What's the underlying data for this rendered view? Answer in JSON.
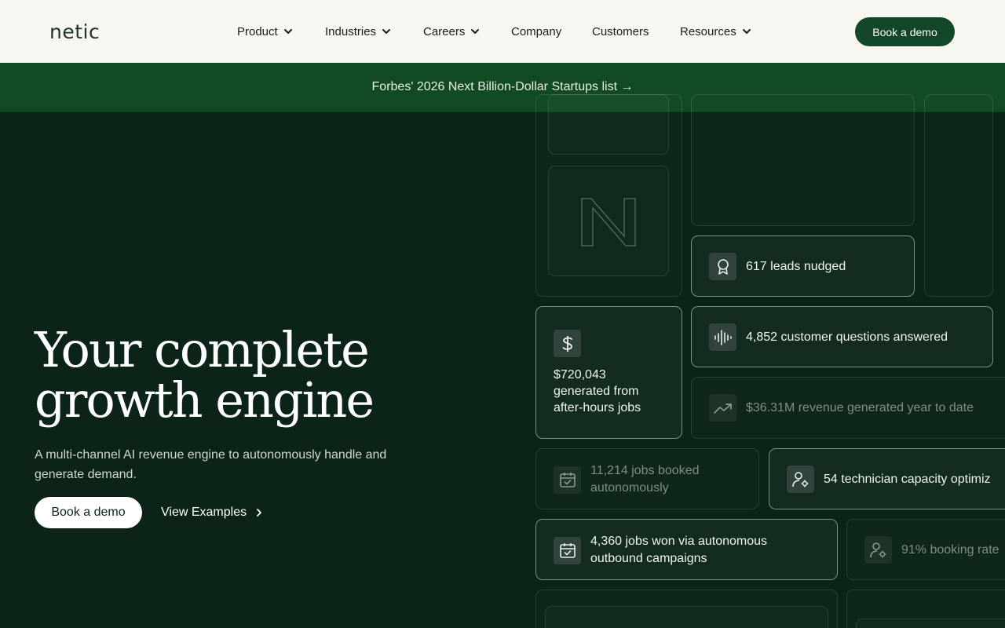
{
  "header": {
    "logo": "netic",
    "nav": [
      {
        "label": "Product",
        "dropdown": true
      },
      {
        "label": "Industries",
        "dropdown": true
      },
      {
        "label": "Careers",
        "dropdown": true
      },
      {
        "label": "Company",
        "dropdown": false
      },
      {
        "label": "Customers",
        "dropdown": false
      },
      {
        "label": "Resources",
        "dropdown": true
      }
    ],
    "cta": "Book a demo"
  },
  "banner": {
    "text": "Forbes' 2026 Next Billion-Dollar Startups list →"
  },
  "hero": {
    "title_line1": "Your complete",
    "title_line2": "growth engine",
    "subtitle": "A multi-channel AI revenue engine to autonomously handle and generate demand.",
    "primary_cta": "Book a demo",
    "secondary_cta": "View Examples"
  },
  "stats": {
    "leads": {
      "text": "617 leads nudged",
      "icon": "award-ribbon-icon"
    },
    "questions": {
      "text": "4,852 customer questions answered",
      "icon": "audio-waveform-icon"
    },
    "after_hours": {
      "text": "$720,043 generated from after-hours jobs",
      "icon": "dollar-icon"
    },
    "revenue": {
      "text": "$36.31M revenue generated year to date",
      "icon": "trending-up-icon"
    },
    "jobs_booked": {
      "text": "11,214 jobs booked autonomously",
      "icon": "calendar-check-icon"
    },
    "technician": {
      "text": "54 technician capacity optimiz",
      "icon": "user-gear-icon"
    },
    "jobs_won": {
      "text": "4,360 jobs won via autonomous outbound campaigns",
      "icon": "calendar-check-icon"
    },
    "booking_rate": {
      "text": "91% booking rate",
      "icon": "user-gear-icon"
    }
  },
  "decor": {
    "letter": "N"
  },
  "colors": {
    "background": "#0c2418",
    "nav_bg": "#f7f6f1",
    "banner_bg": "#124a24",
    "accent": "#13472a"
  }
}
